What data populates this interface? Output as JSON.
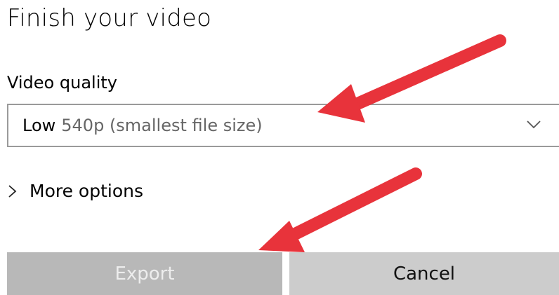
{
  "dialog": {
    "title": "Finish your video",
    "video_quality": {
      "label": "Video quality",
      "selected_level": "Low",
      "selected_detail": "540p (smallest file size)"
    },
    "more_options_label": "More options",
    "buttons": {
      "export_label": "Export",
      "cancel_label": "Cancel"
    }
  },
  "annotations": {
    "arrow_color": "#e8333b"
  },
  "icons": [
    "chevron-down-icon",
    "chevron-right-icon",
    "annotation-arrow"
  ]
}
